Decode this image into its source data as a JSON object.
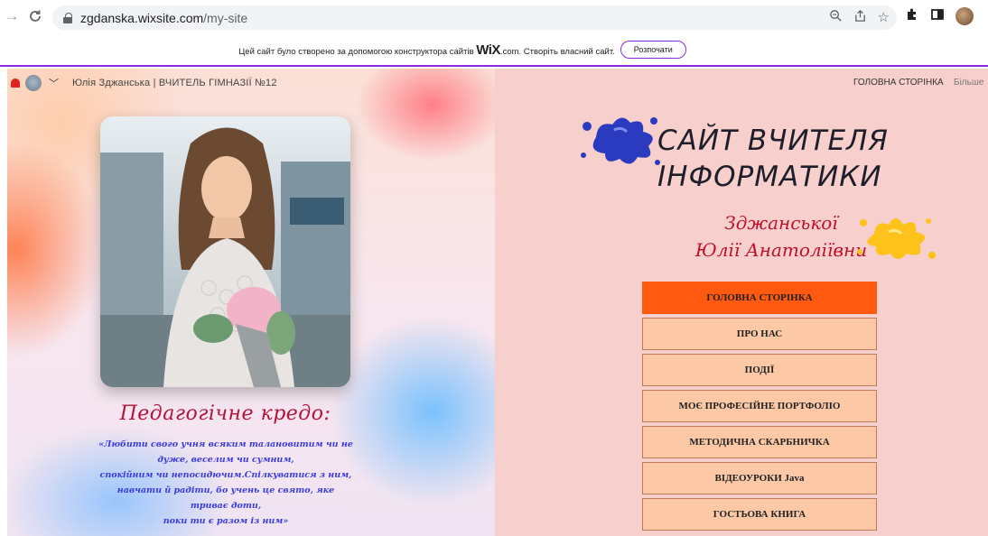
{
  "browser": {
    "url_host": "zgdanska.wixsite.com",
    "url_path": "/my-site"
  },
  "wix_banner": {
    "text": "Цей сайт було створено за допомогою конструктора сайтів",
    "brand": "WiX",
    "text_after": ".com. Створіть власний сайт.",
    "button_label": "Розпочати"
  },
  "header": {
    "site_name": "Юлія Зджанська | ВЧИТЕЛЬ ГІМНАЗІЇ №12",
    "nav_home": "ГОЛОВНА СТОРІНКА",
    "nav_more": "Більше"
  },
  "left": {
    "credo_title": "Педагогічне кредо:",
    "credo_lines": [
      "«Любити свого учня всяким талановитим чи не",
      "дуже, веселим чи сумним,",
      "спокійним чи непосидючим.Спілкуватися з ним,",
      "навчати й радіти, бо учень це свято, яке",
      "триває доти,",
      "поки ти є разом із ним»"
    ]
  },
  "right": {
    "title_line1": "САЙТ ВЧИТЕЛЯ",
    "title_line2": "ІНФОРМАТИКИ",
    "teacher_line1": "Зджанської",
    "teacher_line2": "Юлії Анатоліївни",
    "menu": [
      {
        "label": "ГОЛОВНА СТОРІНКА"
      },
      {
        "label": "ПРО НАС"
      },
      {
        "label": "ПОДІЇ"
      },
      {
        "label": "МОЄ ПРОФЕСІЙНЕ ПОРТФОЛІО"
      },
      {
        "label": "МЕТОДИЧНА СКАРБНИЧКА"
      },
      {
        "label": "ВІДЕОУРОКИ Java"
      },
      {
        "label": "ГОСТЬОВА КНИГА"
      }
    ],
    "active_index": 0
  },
  "colors": {
    "accent_orange": "#ff5a0f",
    "menu_bg": "#fcc8a6",
    "title_red": "#c0102a",
    "credo_blue": "#3a3be0",
    "wix_purple": "#8a2be2"
  },
  "icons": [
    "back-arrow-icon",
    "reload-icon",
    "lock-icon",
    "zoom-icon",
    "share-icon",
    "star-icon",
    "extensions-icon",
    "sidebar-icon",
    "profile-avatar",
    "bell-icon",
    "chevron-down-icon",
    "blue-paint-splat",
    "yellow-paint-splat"
  ]
}
